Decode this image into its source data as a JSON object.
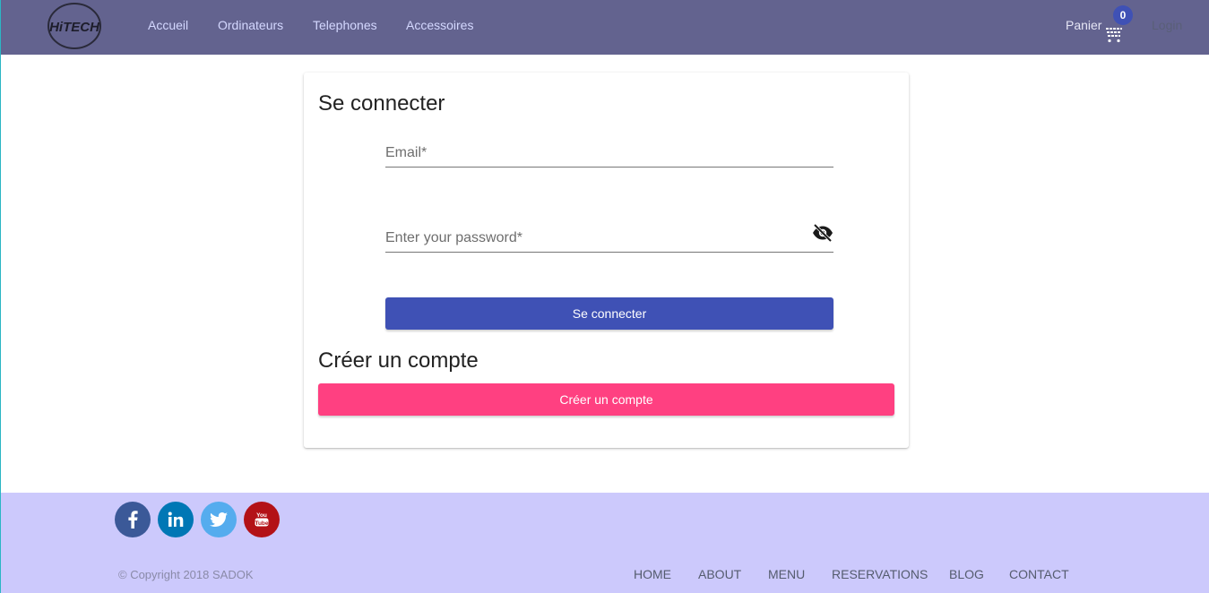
{
  "header": {
    "logo_text": "HiTECH",
    "nav": [
      "Accueil",
      "Ordinateurs",
      "Telephones",
      "Accessoires"
    ],
    "cart_label": "Panier",
    "cart_count": "0",
    "login_label": "Login"
  },
  "login": {
    "title": "Se connecter",
    "email_placeholder": "Email*",
    "password_placeholder": "Enter your password*",
    "submit_label": "Se connecter"
  },
  "register": {
    "title": "Créer un compte",
    "button_label": "Créer un compte"
  },
  "footer": {
    "social": [
      "facebook-icon",
      "linkedin-icon",
      "twitter-icon",
      "youtube-icon"
    ],
    "copyright": "© Copyright 2018 SADOK",
    "links": [
      "HOME",
      "ABOUT",
      "MENU",
      "RESERVATIONS",
      "BLOG",
      "CONTACT"
    ]
  },
  "colors": {
    "header_bg": "#63638f",
    "primary": "#3f51b5",
    "accent": "#ff4081",
    "footer_bg": "#ccc9fc"
  }
}
